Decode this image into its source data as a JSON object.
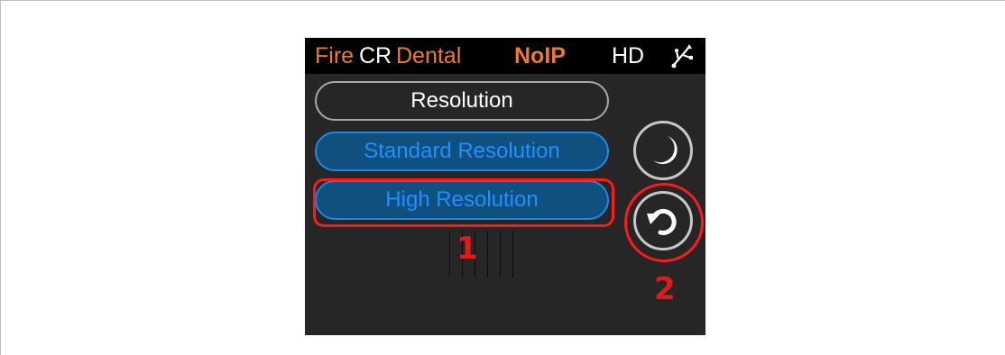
{
  "status_bar": {
    "brand_part1": "Fire",
    "brand_part2": "CR",
    "product": "Dental",
    "network": "NoIP",
    "mode": "HD",
    "usb_icon": "usb-icon",
    "colors": {
      "accent": "#ee7b27",
      "text": "#ffffff",
      "background": "#000000"
    }
  },
  "menu": {
    "header_label": "Resolution",
    "options": [
      {
        "label": "Standard Resolution"
      },
      {
        "label": "High Resolution"
      }
    ],
    "colors": {
      "option_text": "#1e90ff",
      "option_fill": "#10507f",
      "option_border": "#1e88e5"
    }
  },
  "side_buttons": {
    "sleep_icon": "moon-icon",
    "back_icon": "undo-arrow-icon"
  },
  "annotations": {
    "callout_1": "1",
    "callout_2": "2",
    "color": "#ff1a1a"
  }
}
